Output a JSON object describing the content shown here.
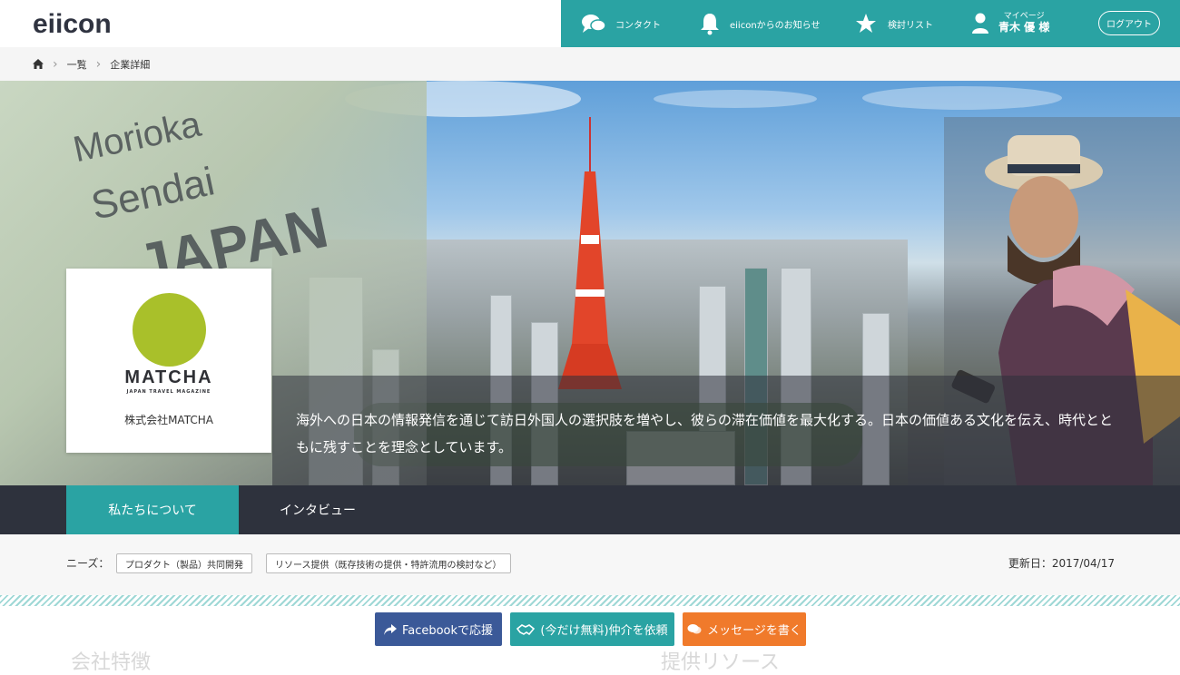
{
  "header": {
    "logo": "eiicon",
    "nav": {
      "contact": "コンタクト",
      "news": "eiiconからのお知らせ",
      "list": "検討リスト",
      "mypage_sub": "マイページ",
      "mypage_name": "青木 優 様",
      "logout": "ログアウト"
    }
  },
  "breadcrumb": {
    "items": [
      "一覧",
      "企業詳細"
    ]
  },
  "hero": {
    "map_words": [
      "Morioka",
      "Sendai",
      "JAPAN"
    ],
    "tagline": "海外への日本の情報発信を通じて訪日外国人の選択肢を増やし、彼らの滞在価値を最大化する。日本の価値ある文化を伝え、時代とともに残すことを理念としています。"
  },
  "company": {
    "logo_word": "MATCHA",
    "logo_sub": "JAPAN TRAVEL MAGAZINE",
    "name": "株式会社MATCHA"
  },
  "tabs": [
    "私たちについて",
    "インタビュー"
  ],
  "meta": {
    "needs_label": "ニーズ：",
    "needs": [
      "プロダクト（製品）共同開発",
      "リソース提供（既存技術の提供・特許流用の検討など）"
    ],
    "updated": "更新日：2017/04/17"
  },
  "actions": {
    "facebook": "Facebookで応援",
    "intro": "(今だけ無料)仲介を依頼",
    "message": "メッセージを書く"
  },
  "sections": [
    "会社特徴",
    "提供リソース"
  ],
  "colors": {
    "teal": "#2aa3a3",
    "dark": "#2e323d",
    "facebook": "#3b5998",
    "orange": "#f07a2b",
    "matcha": "#a9c02a"
  }
}
